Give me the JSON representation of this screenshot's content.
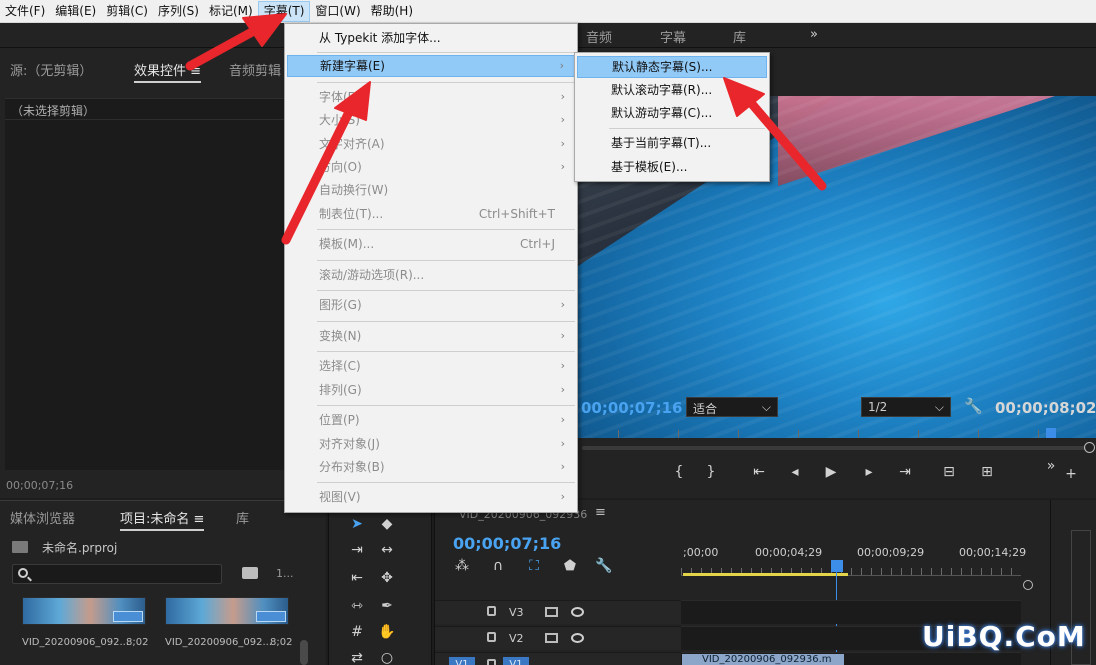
{
  "menubar": {
    "items": [
      "文件(F)",
      "编辑(E)",
      "剪辑(C)",
      "序列(S)",
      "标记(M)",
      "字幕(T)",
      "窗口(W)",
      "帮助(H)"
    ]
  },
  "workspace_tabs": [
    "音频",
    "字幕",
    "库",
    "»"
  ],
  "source_panel": {
    "tabs": [
      "源:（无剪辑）",
      "效果控件 ≡",
      "音频剪辑"
    ],
    "no_clip": "（未选择剪辑）",
    "timecode": "00;00;07;16"
  },
  "project_panel": {
    "tabs": [
      "媒体浏览器",
      "项目:未命名 ≡",
      "库"
    ],
    "file": "未命名.prproj",
    "more": "1...",
    "clips": [
      {
        "name": "VID_20200906_092...",
        "duration": "8;02"
      },
      {
        "name": "VID_20200906_092...",
        "duration": "8;02"
      }
    ]
  },
  "monitor": {
    "timecode_current": "00;00;07;16",
    "zoom": "适合",
    "resolution": "1/2",
    "timecode_duration": "00;00;08;02"
  },
  "timeline": {
    "tab": "VID_20200906_092936",
    "menu": "≡",
    "timecode": "00;00;07;16",
    "ruler": [
      ";00;00",
      "00;00;04;29",
      "00;00;09;29",
      "00;00;14;29"
    ],
    "tracks": [
      "V3",
      "V2",
      "V1"
    ],
    "clip_name": "VID_20200906_092936.m",
    "v1_label": "V1"
  },
  "dropdown": {
    "items": [
      {
        "label": "从 Typekit 添加字体...",
        "disabled": false
      },
      {
        "label": "新建字幕(E)",
        "disabled": false,
        "submenu": true,
        "hover": true
      },
      {
        "label": "字体(F)",
        "disabled": true,
        "submenu": true
      },
      {
        "label": "大小(S)",
        "disabled": true,
        "submenu": true
      },
      {
        "label": "文字对齐(A)",
        "disabled": true,
        "submenu": true
      },
      {
        "label": "方向(O)",
        "disabled": true,
        "submenu": true
      },
      {
        "label": "自动换行(W)",
        "disabled": true
      },
      {
        "label": "制表位(T)...",
        "disabled": true,
        "shortcut": "Ctrl+Shift+T"
      },
      {
        "label": "模板(M)...",
        "disabled": true,
        "shortcut": "Ctrl+J"
      },
      {
        "label": "滚动/游动选项(R)...",
        "disabled": true
      },
      {
        "label": "图形(G)",
        "disabled": true,
        "submenu": true
      },
      {
        "label": "变换(N)",
        "disabled": true,
        "submenu": true
      },
      {
        "label": "选择(C)",
        "disabled": true,
        "submenu": true
      },
      {
        "label": "排列(G)",
        "disabled": true,
        "submenu": true
      },
      {
        "label": "位置(P)",
        "disabled": true,
        "submenu": true
      },
      {
        "label": "对齐对象(J)",
        "disabled": true,
        "submenu": true
      },
      {
        "label": "分布对象(B)",
        "disabled": true,
        "submenu": true
      },
      {
        "label": "视图(V)",
        "disabled": true,
        "submenu": true
      }
    ]
  },
  "submenu": {
    "items": [
      "默认静态字幕(S)...",
      "默认滚动字幕(R)...",
      "默认游动字幕(C)...",
      "基于当前字幕(T)...",
      "基于模板(E)..."
    ]
  },
  "colors": {
    "accent_blue": "#4aa3f0",
    "menu_highlight": "#91c9f7",
    "annotation_red": "#e8262b",
    "workarea_yellow": "#e4d44a"
  },
  "watermark": "UiBQ.CoM"
}
